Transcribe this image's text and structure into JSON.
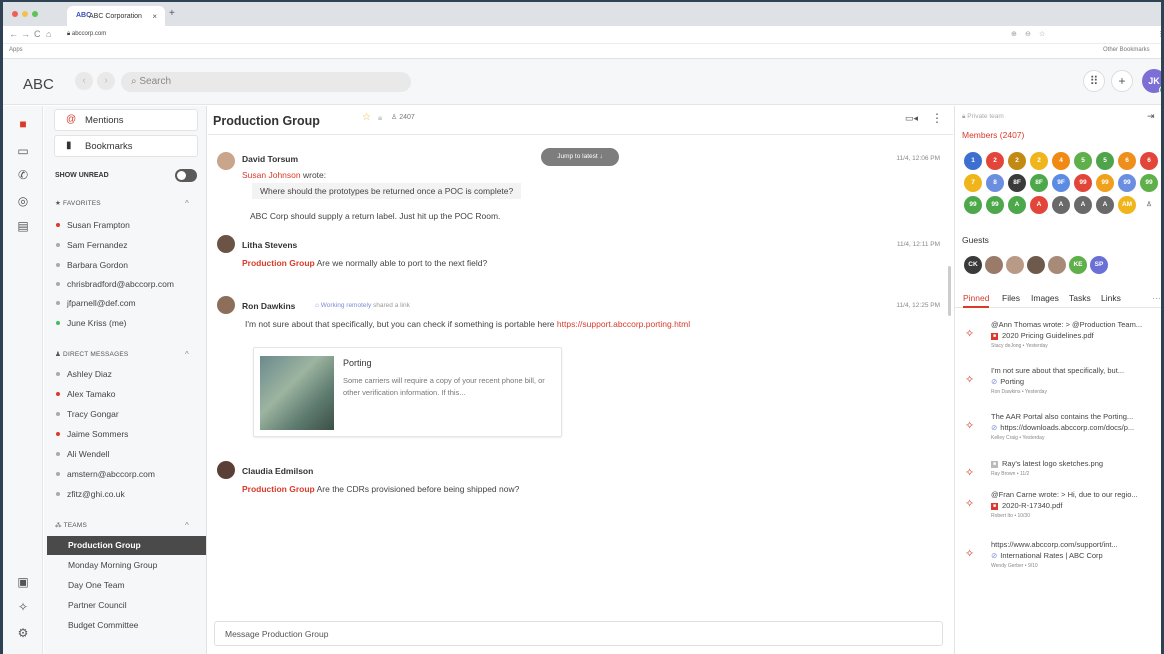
{
  "browser": {
    "tab_title": "ABC Corporation",
    "tab_logo": "ABC",
    "url": "abccorp.com",
    "apps_label": "Apps",
    "other_bookmarks": "Other Bookmarks"
  },
  "header": {
    "brand": "ABC",
    "search_placeholder": "Search",
    "avatar_initials": "JK"
  },
  "left_panel": {
    "mentions": "Mentions",
    "bookmarks": "Bookmarks",
    "show_unread": "SHOW UNREAD",
    "favorites_header": "FAVORITES",
    "favorites": [
      "Susan Frampton",
      "Sam Fernandez",
      "Barbara Gordon",
      "chrisbradford@abccorp.com",
      "jfparnell@def.com",
      "June Kriss (me)"
    ],
    "dm_header": "DIRECT MESSAGES",
    "direct_messages": [
      "Ashley Diaz",
      "Alex Tamako",
      "Tracy Gongar",
      "Jaime Sommers",
      "Ali Wendell",
      "amstern@abccorp.com",
      "zfitz@ghi.co.uk"
    ],
    "teams_header": "TEAMS",
    "teams": [
      "Production Group",
      "Monday Morning Group",
      "Day One Team",
      "Partner Council",
      "Budget Committee"
    ]
  },
  "main": {
    "title": "Production Group",
    "member_count": "2407",
    "jump_label": "Jump to latest",
    "messages": [
      {
        "author": "David Torsum",
        "time": "11/4, 12:06 PM",
        "quote_author": "Susan Johnson",
        "quote_suffix": "wrote:",
        "quote": "Where should the prototypes be returned once a POC is complete?",
        "text": "ABC Corp should supply a return label. Just hit up the POC Room."
      },
      {
        "author": "Litha Stevens",
        "time": "11/4, 12:11 PM",
        "tag": "Production Group",
        "text": "Are we normally able to port to the next field?"
      },
      {
        "author": "Ron Dawkins",
        "status": "Working remotely",
        "status_suffix": "shared a link",
        "time": "11/4, 12:25 PM",
        "text": "I'm not sure about that specifically, but you can check if something is portable here",
        "link": "https://support.abccorp.porting.html"
      },
      {
        "author": "Claudia Edmilson",
        "tag": "Production Group",
        "text": "Are the CDRs provisioned before being shipped now?"
      }
    ],
    "link_card": {
      "title": "Porting",
      "body": "Some carriers will require a copy of your recent phone bill, or other verification information. If this..."
    },
    "compose_placeholder": "Message Production Group"
  },
  "right_panel": {
    "private_label": "Private team",
    "members_header": "Members (2407)",
    "member_badges": [
      "1",
      "2",
      "2",
      "2",
      "4",
      "5",
      "5",
      "6",
      "6",
      "7",
      "8",
      "8F",
      "8F",
      "9F",
      "99",
      "99",
      "99",
      "99",
      "99",
      "99",
      "A",
      "A",
      "A",
      "A",
      "A",
      "AM"
    ],
    "guests_header": "Guests",
    "guests": [
      "CK",
      "",
      "",
      "",
      "",
      "KE",
      "SP"
    ],
    "tabs": [
      "Pinned",
      "Files",
      "Images",
      "Tasks",
      "Links"
    ],
    "pins": [
      {
        "line1": "@Ann Thomas wrote: > @Production Team...",
        "line2": "2020 Pricing Guidelines.pdf",
        "meta": "Stacy deJong • Yesterday"
      },
      {
        "line1": "I'm not sure about that specifically, but...",
        "line2": "Porting",
        "meta": "Ron Dawkins • Yesterday"
      },
      {
        "line1": "The AAR Portal also contains the Porting...",
        "line2": "https://downloads.abccorp.com/docs/p...",
        "meta": "Kelley Craig • Yesterday"
      },
      {
        "line1": "Ray's latest logo sketches.png",
        "line2": "",
        "meta": "Ray Brown • 11/2"
      },
      {
        "line1": "@Fran Carne wrote: > Hi, due to our regio...",
        "line2": "2020-R-17340.pdf",
        "meta": "Robert Ito • 10/30"
      },
      {
        "line1": "https://www.abccorp.com/support/int...",
        "line2": "International Rates | ABC Corp",
        "meta": "Wendy Gerber • 9/10"
      }
    ]
  },
  "colors": {
    "accent": "#d93a2b",
    "dark": "#4a4a4a",
    "brand_blue": "#3b4fb8"
  }
}
